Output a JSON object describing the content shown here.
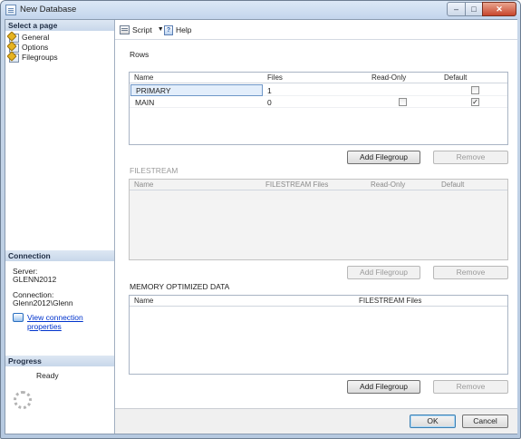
{
  "window": {
    "title": "New Database",
    "minimize": "–",
    "maximize": "□",
    "close": "✕"
  },
  "sidebar": {
    "select_page_header": "Select a page",
    "pages": [
      {
        "label": "General",
        "icon": "page-icon"
      },
      {
        "label": "Options",
        "icon": "page-icon"
      },
      {
        "label": "Filegroups",
        "icon": "page-icon"
      }
    ],
    "connection": {
      "header": "Connection",
      "server_label": "Server:",
      "server_value": "GLENN2012",
      "connection_label": "Connection:",
      "connection_value": "Glenn2012\\Glenn",
      "view_properties_link": "View connection properties"
    },
    "progress": {
      "header": "Progress",
      "status": "Ready"
    }
  },
  "toolbar": {
    "script_label": "Script",
    "help_label": "Help"
  },
  "rows_section": {
    "label": "Rows",
    "columns": [
      "Name",
      "Files",
      "Read-Only",
      "Default"
    ],
    "rows": [
      {
        "name": "PRIMARY",
        "files": "1",
        "read_only": null,
        "default": false
      },
      {
        "name": "MAIN",
        "files": "0",
        "read_only": false,
        "default": true
      }
    ],
    "add_button": "Add Filegroup",
    "remove_button": "Remove"
  },
  "filestream_section": {
    "label": "FILESTREAM",
    "columns": [
      "Name",
      "FILESTREAM Files",
      "Read-Only",
      "Default"
    ],
    "add_button": "Add Filegroup",
    "remove_button": "Remove"
  },
  "memory_section": {
    "label": "MEMORY OPTIMIZED DATA",
    "columns": [
      "Name",
      "FILESTREAM Files"
    ],
    "add_button": "Add Filegroup",
    "remove_button": "Remove"
  },
  "footer": {
    "ok_button": "OK",
    "cancel_button": "Cancel"
  }
}
